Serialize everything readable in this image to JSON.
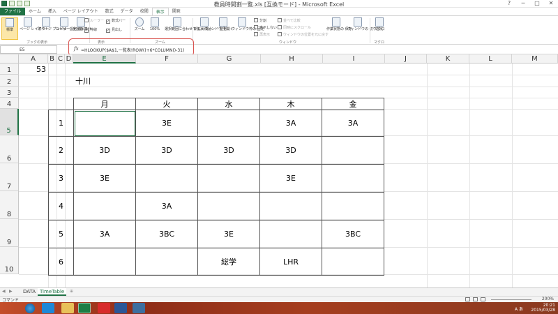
{
  "window": {
    "title": "教員時間割一覧.xls [互換モード] - Microsoft Excel",
    "controls": [
      "?",
      "─",
      "□",
      "✕"
    ]
  },
  "ribbon": {
    "tabs": [
      "ファイル",
      "ホーム",
      "挿入",
      "ページ レイアウト",
      "数式",
      "データ",
      "校閲",
      "表示",
      "開発"
    ],
    "active_tab": "表示",
    "buttons": {
      "normal": "標準",
      "page_layout": "ページ レイアウト",
      "page_break": "改ページ プレビュー",
      "custom_view": "ユーザー設定 のビュー",
      "full_screen": "全画面 表示",
      "zoom": "ズーム",
      "zoom100": "100%",
      "zoom_selection": "選択範囲に合わせて 拡大/縮小",
      "new_window": "新しいウィンドウ を開く",
      "arrange": "整列",
      "freeze": "ウィンドウ枠の 固定",
      "save_workspace": "作業状態の 保存",
      "switch_window": "ウィンドウの 切り替え",
      "macro": "マクロ"
    },
    "checks": {
      "ruler": "ルーラー",
      "formula_bar": "数式バー",
      "gridlines": "枠線",
      "headings": "見出し",
      "split": "分割",
      "hide": "表示しない",
      "unhide": "再表示",
      "side_by_side": "並べて比較",
      "sync_scroll": "同時にスクロール",
      "reset_pos": "ウィンドウの位置を元に戻す"
    },
    "groups": {
      "workbook_views": "ブックの表示",
      "show": "表示",
      "zoom": "ズーム",
      "window": "ウィンドウ",
      "macros": "マクロ"
    }
  },
  "formula_bar": {
    "name_box": "E5",
    "fx": "fx",
    "formula": "=HLOOKUP($A$1,一覧表!ROW()+6*COLUMN()-31)"
  },
  "sheet": {
    "columns": [
      "A",
      "B",
      "C",
      "D",
      "E",
      "F",
      "G",
      "H",
      "I",
      "J",
      "K",
      "L",
      "M"
    ],
    "rows": [
      "1",
      "2",
      "3",
      "4",
      "5",
      "6",
      "7",
      "8",
      "9",
      "10"
    ],
    "a1": "53",
    "teacher": "十川"
  },
  "timetable": {
    "days": [
      "月",
      "火",
      "水",
      "木",
      "金"
    ],
    "periods": [
      {
        "num": "1",
        "cells": [
          "",
          "3E",
          "",
          "3A",
          "3A"
        ]
      },
      {
        "num": "2",
        "cells": [
          "3D",
          "3D",
          "3D",
          "3D",
          ""
        ]
      },
      {
        "num": "3",
        "cells": [
          "3E",
          "",
          "",
          "3E",
          ""
        ]
      },
      {
        "num": "4",
        "cells": [
          "",
          "3A",
          "",
          "",
          ""
        ]
      },
      {
        "num": "5",
        "cells": [
          "3A",
          "3BC",
          "3E",
          "",
          "3BC"
        ]
      },
      {
        "num": "6",
        "cells": [
          "",
          "",
          "総学",
          "LHR",
          ""
        ]
      }
    ]
  },
  "sheet_tabs": [
    "DATA",
    "TimeTable"
  ],
  "status": {
    "mode": "コマンド",
    "zoom": "200%"
  },
  "taskbar": {
    "time": "20:21",
    "date": "2015/03/28",
    "ime": "A",
    "ime_mode": "あ"
  },
  "colors": {
    "excel_green": "#207245",
    "highlight_red": "#d9534f",
    "selected_tab_yellow": "#fce7a8"
  }
}
